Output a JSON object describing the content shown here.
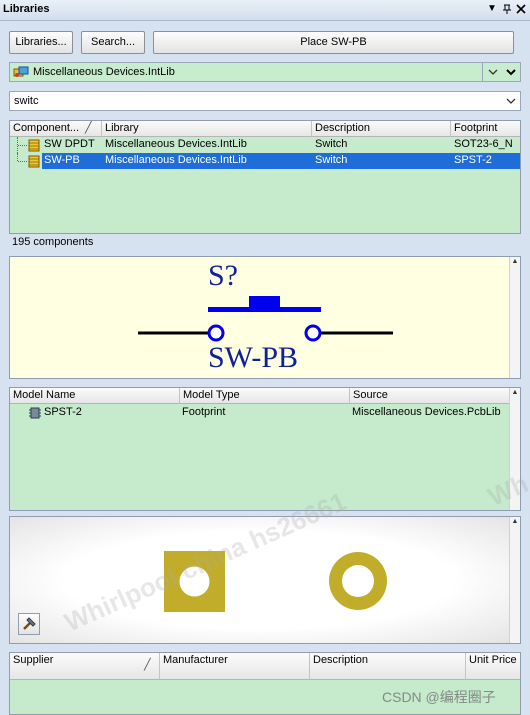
{
  "panel": {
    "title": "Libraries"
  },
  "toolbar": {
    "libraries_label": "Libraries...",
    "search_label": "Search...",
    "place_label": "Place SW-PB"
  },
  "library_select": {
    "value": "Miscellaneous Devices.IntLib"
  },
  "filter": {
    "value": "switc"
  },
  "components": {
    "columns": [
      "Component...",
      "Library",
      "Description",
      "Footprint"
    ],
    "rows": [
      {
        "name": "SW DPDT",
        "library": "Miscellaneous Devices.IntLib",
        "description": "Switch",
        "footprint": "SOT23-6_N",
        "selected": false
      },
      {
        "name": "SW-PB",
        "library": "Miscellaneous Devices.IntLib",
        "description": "Switch",
        "footprint": "SPST-2",
        "selected": true
      }
    ],
    "count_text": "195 components"
  },
  "schematic": {
    "designator": "S?",
    "comment": "SW-PB"
  },
  "models": {
    "columns": [
      "Model Name",
      "Model Type",
      "Source"
    ],
    "rows": [
      {
        "name": "SPST-2",
        "type": "Footprint",
        "source": "Miscellaneous Devices.PcbLib"
      }
    ]
  },
  "supplier": {
    "columns": [
      "Supplier",
      "Manufacturer",
      "Description",
      "Unit Price"
    ]
  },
  "watermark": {
    "text": "Whirlpool china  hs26661",
    "text2": "Wh"
  },
  "credit": {
    "text": "CSDN @编程圈子"
  },
  "colors": {
    "grid_bg": "#c5ebcc",
    "selection": "#1f6dd8",
    "schematic_bg": "#ffffe1",
    "symbol": "#0000ee",
    "pad": "#c2ad2a"
  }
}
